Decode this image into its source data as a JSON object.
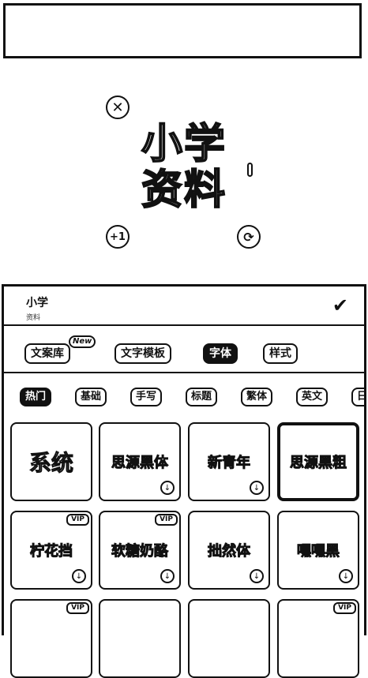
{
  "canvas": {
    "sticker_line1": "小学",
    "sticker_line2": "资料",
    "plus_label": "+1"
  },
  "panel": {
    "input_text": "小学",
    "input_sub": "资料",
    "tabs": [
      {
        "label": "文案库"
      },
      {
        "label": "文字模板"
      },
      {
        "label": "字体"
      },
      {
        "label": "样式"
      }
    ],
    "new_badge": "New",
    "categories": [
      {
        "label": "热门"
      },
      {
        "label": "基础"
      },
      {
        "label": "手写"
      },
      {
        "label": "标题"
      },
      {
        "label": "繁体"
      },
      {
        "label": "英文"
      },
      {
        "label": "日"
      }
    ],
    "fonts": [
      {
        "name": "系统"
      },
      {
        "name": "思源黑体"
      },
      {
        "name": "新青年"
      },
      {
        "name": "思源黑粗"
      },
      {
        "name": "柠花挡"
      },
      {
        "name": "软糖奶酪"
      },
      {
        "name": "拙然体"
      },
      {
        "name": "嘿嘿黑"
      }
    ],
    "vip_label": "VIP"
  },
  "colors": {
    "ink": "#111111",
    "bg": "#ffffff"
  }
}
